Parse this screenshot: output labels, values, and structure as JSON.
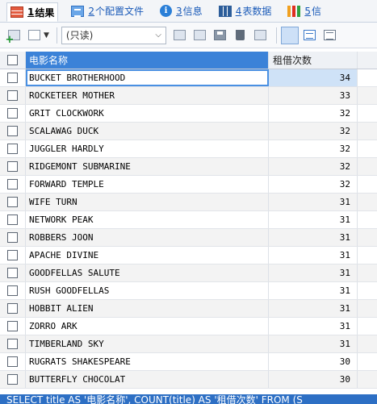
{
  "tabs": [
    {
      "num": "1",
      "label": "结果",
      "icon": "result-grid-icon",
      "active": true
    },
    {
      "num": "2",
      "label": "个配置文件",
      "icon": "config-files-icon",
      "active": false
    },
    {
      "num": "3",
      "label": "信息",
      "icon": "info-icon",
      "active": false
    },
    {
      "num": "4",
      "label": "表数据",
      "icon": "table-data-icon",
      "active": false
    },
    {
      "num": "5",
      "label": "信",
      "icon": "bar-chart-icon",
      "active": false
    }
  ],
  "toolbar": {
    "mode_select_value": "(只读)"
  },
  "columns": {
    "title": "电影名称",
    "count": "租借次数"
  },
  "rows": [
    {
      "title": "BUCKET BROTHERHOOD",
      "count": "34"
    },
    {
      "title": "ROCKETEER MOTHER",
      "count": "33"
    },
    {
      "title": "GRIT CLOCKWORK",
      "count": "32"
    },
    {
      "title": "SCALAWAG DUCK",
      "count": "32"
    },
    {
      "title": "JUGGLER HARDLY",
      "count": "32"
    },
    {
      "title": "RIDGEMONT SUBMARINE",
      "count": "32"
    },
    {
      "title": "FORWARD TEMPLE",
      "count": "32"
    },
    {
      "title": "WIFE TURN",
      "count": "31"
    },
    {
      "title": "NETWORK PEAK",
      "count": "31"
    },
    {
      "title": "ROBBERS JOON",
      "count": "31"
    },
    {
      "title": "APACHE DIVINE",
      "count": "31"
    },
    {
      "title": "GOODFELLAS SALUTE",
      "count": "31"
    },
    {
      "title": "RUSH GOODFELLAS",
      "count": "31"
    },
    {
      "title": "HOBBIT ALIEN",
      "count": "31"
    },
    {
      "title": "ZORRO ARK",
      "count": "31"
    },
    {
      "title": "TIMBERLAND SKY",
      "count": "31"
    },
    {
      "title": "RUGRATS SHAKESPEARE",
      "count": "30"
    },
    {
      "title": "BUTTERFLY CHOCOLAT",
      "count": "30"
    }
  ],
  "sql_preview": "SELECT title AS '电影名称', COUNT(title) AS '租借次数' FROM (S",
  "colors": {
    "header_selected": "#3b82d8",
    "selected_cell_border": "#4a90e2",
    "sql_bar": "#2d6fc4"
  }
}
